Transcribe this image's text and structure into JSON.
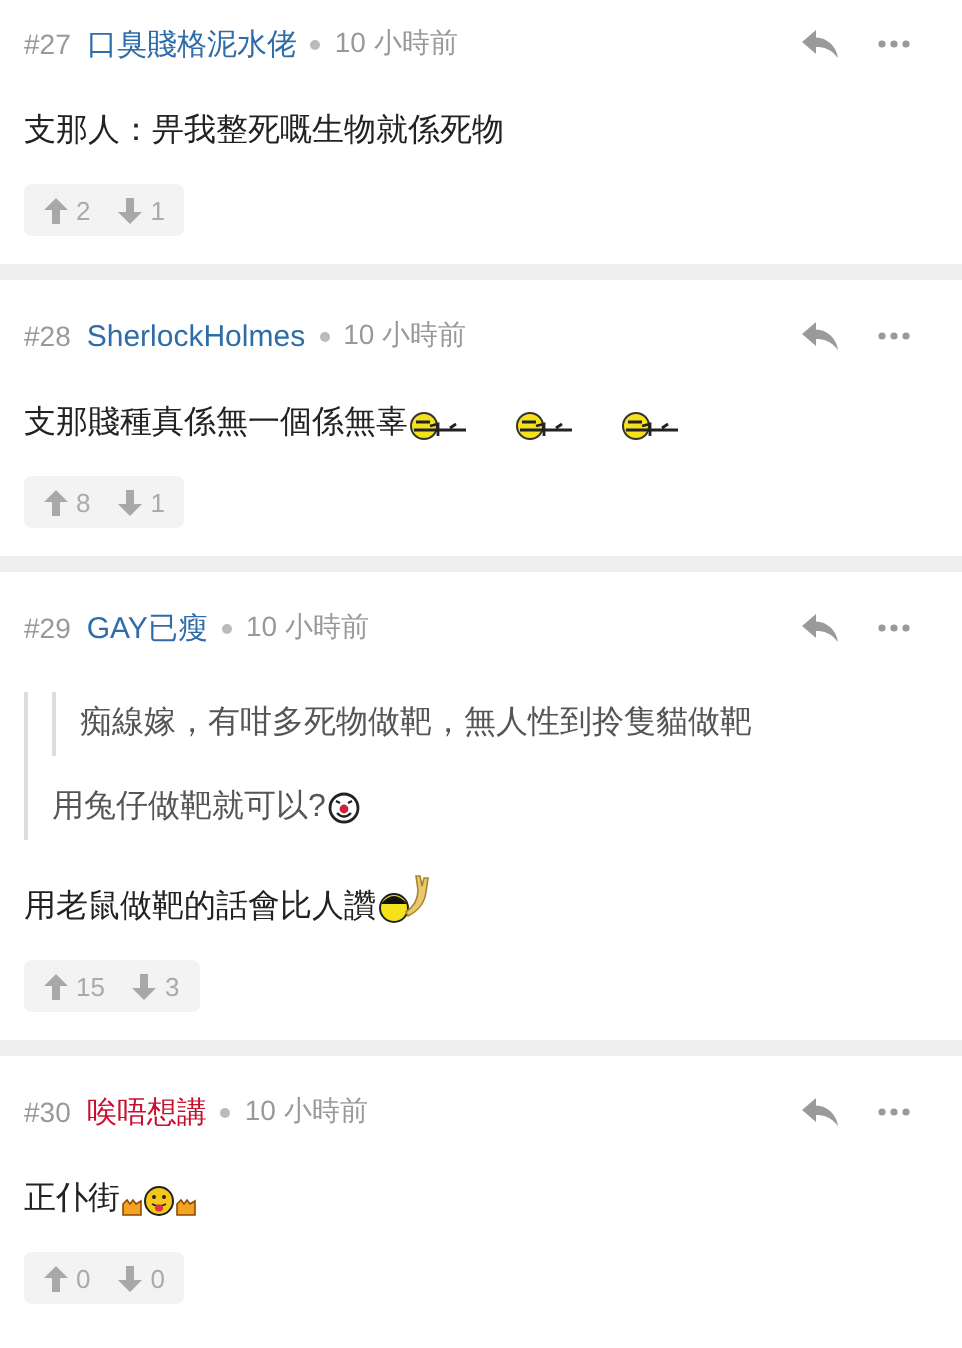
{
  "comments": [
    {
      "number": "#27",
      "author": "口臭賤格泥水佬",
      "color": "#2f6da8",
      "time": "10 小時前",
      "body": [
        {
          "kind": "text",
          "text": "支那人：畀我整死嘅生物就係死物"
        }
      ],
      "upvotes": "2",
      "downvotes": "1"
    },
    {
      "number": "#28",
      "author": "SherlockHolmes",
      "color": "#2f6da8",
      "time": "10 小時前",
      "body": [
        {
          "kind": "text",
          "text": "支那賤種真係無一個係無辜",
          "emoticons": [
            {
              "kind": "gun"
            },
            {
              "kind": "gun"
            },
            {
              "kind": "gun"
            }
          ]
        }
      ],
      "upvotes": "8",
      "downvotes": "1"
    },
    {
      "number": "#29",
      "author": "GAY已瘦",
      "color": "#2f6da8",
      "time": "10 小時前",
      "body": [
        {
          "kind": "quote",
          "children": [
            {
              "kind": "quote",
              "text": "痴線嫁，有咁多死物做靶，無人性到拎隻貓做靶"
            },
            {
              "kind": "text",
              "text": "用兔仔做靶就可以?",
              "emoticons": [
                {
                  "kind": "clown"
                }
              ]
            }
          ]
        },
        {
          "kind": "text",
          "text": "用老鼠做靶的話會比人讚",
          "emoticons": [
            {
              "kind": "rock"
            }
          ]
        }
      ],
      "upvotes": "15",
      "downvotes": "3"
    },
    {
      "number": "#30",
      "author": "唉唔想講",
      "color": "#c8102e",
      "time": "10 小時前",
      "body": [
        {
          "kind": "text",
          "text": "正仆街",
          "emoticons": [
            {
              "kind": "fist"
            },
            {
              "kind": "tongue"
            },
            {
              "kind": "fist"
            }
          ]
        }
      ],
      "upvotes": "0",
      "downvotes": "0"
    }
  ]
}
